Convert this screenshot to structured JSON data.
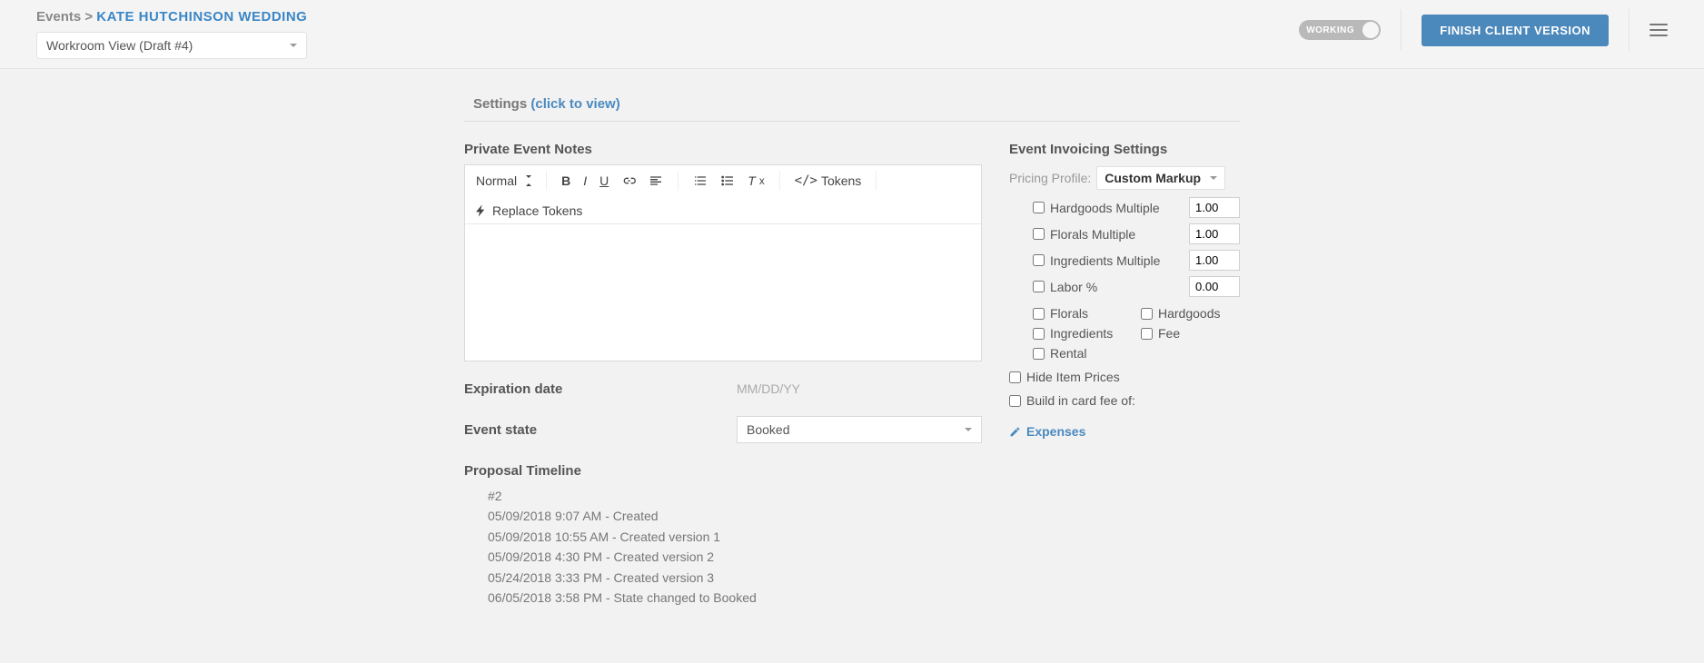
{
  "breadcrumb": {
    "parent": "Events >",
    "current": "KATE HUTCHINSON WEDDING"
  },
  "viewSelect": "Workroom View (Draft #4)",
  "toggle": {
    "label": "WORKING"
  },
  "primaryButton": "FINISH CLIENT VERSION",
  "settings": {
    "label": "Settings",
    "link": "(click to view)"
  },
  "notes": {
    "heading": "Private Event Notes"
  },
  "editor": {
    "format": "Normal",
    "tokens": "Tokens",
    "replaceTokens": "Replace Tokens"
  },
  "expiration": {
    "label": "Expiration date",
    "placeholder": "MM/DD/YY"
  },
  "eventState": {
    "label": "Event state",
    "value": "Booked"
  },
  "timeline": {
    "heading": "Proposal Timeline",
    "id": "#2",
    "entries": [
      "05/09/2018 9:07 AM - Created",
      "05/09/2018 10:55 AM - Created version 1",
      "05/09/2018 4:30 PM - Created version 2",
      "05/24/2018 3:33 PM - Created version 3",
      "06/05/2018 3:58 PM - State changed to Booked"
    ]
  },
  "invoicing": {
    "heading": "Event Invoicing Settings",
    "pricingLabel": "Pricing Profile:",
    "pricingValue": "Custom Markup",
    "multiples": {
      "hardgoods": {
        "label": "Hardgoods Multiple",
        "value": "1.00"
      },
      "florals": {
        "label": "Florals Multiple",
        "value": "1.00"
      },
      "ingredients": {
        "label": "Ingredients Multiple",
        "value": "1.00"
      },
      "labor": {
        "label": "Labor %",
        "value": "0.00"
      }
    },
    "categories": {
      "florals": "Florals",
      "hardgoods": "Hardgoods",
      "ingredients": "Ingredients",
      "fee": "Fee",
      "rental": "Rental"
    },
    "hidePrices": "Hide Item Prices",
    "cardFee": "Build in card fee of:",
    "expenses": "Expenses"
  }
}
